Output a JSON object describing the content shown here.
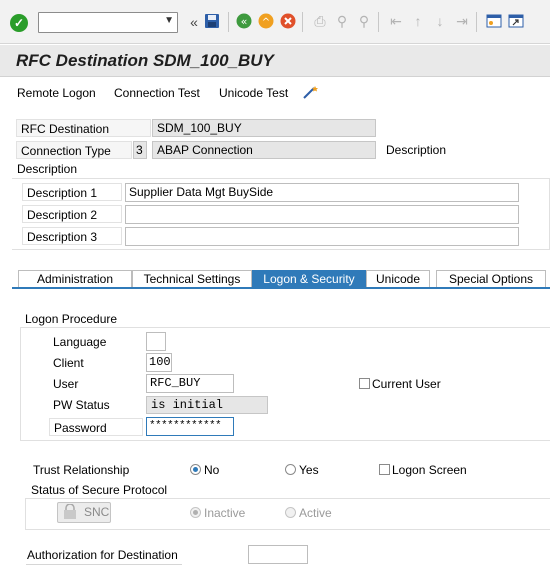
{
  "toolbar": {
    "command_placeholder": "",
    "icons": [
      "check-icon",
      "dropdown-icon",
      "back-arrows-icon",
      "save-icon",
      "back-icon",
      "exit-icon",
      "cancel-icon",
      "print-icon",
      "find-icon",
      "find-next-icon",
      "first-page-icon",
      "prev-page-icon",
      "next-page-icon",
      "last-page-icon",
      "create-session-icon",
      "shortcut-icon"
    ]
  },
  "title": "RFC Destination SDM_100_BUY",
  "app_toolbar": {
    "remote_logon": "Remote Logon",
    "connection_test": "Connection Test",
    "unicode_test": "Unicode Test"
  },
  "header": {
    "rfc_destination_label": "RFC Destination",
    "rfc_destination_value": "SDM_100_BUY",
    "connection_type_label": "Connection Type",
    "connection_type_code": "3",
    "connection_type_text": "ABAP Connection",
    "description_link": "Description"
  },
  "description": {
    "group_title": "Description",
    "rows": [
      {
        "label": "Description 1",
        "value": "Supplier Data Mgt BuySide"
      },
      {
        "label": "Description 2",
        "value": ""
      },
      {
        "label": "Description 3",
        "value": ""
      }
    ]
  },
  "tabs": [
    "Administration",
    "Technical Settings",
    "Logon & Security",
    "Unicode",
    "Special Options"
  ],
  "logon": {
    "group_title": "Logon Procedure",
    "language_label": "Language",
    "language_value": "",
    "client_label": "Client",
    "client_value": "100",
    "user_label": "User",
    "user_value": "RFC_BUY",
    "current_user_label": "Current User",
    "pw_status_label": "PW Status",
    "pw_status_value": "is initial",
    "password_label": "Password",
    "password_value": "************"
  },
  "trust": {
    "label": "Trust Relationship",
    "no": "No",
    "yes": "Yes",
    "logon_screen": "Logon Screen"
  },
  "secure": {
    "group_title": "Status of Secure Protocol",
    "snc_button": "SNC",
    "inactive": "Inactive",
    "active": "Active"
  },
  "authorization": {
    "label": "Authorization for Destination",
    "value": ""
  },
  "colors": {
    "accent": "#2f7ab9",
    "toolbar_bg": "#f2f2f2",
    "title_bg": "#e9e9e9"
  }
}
